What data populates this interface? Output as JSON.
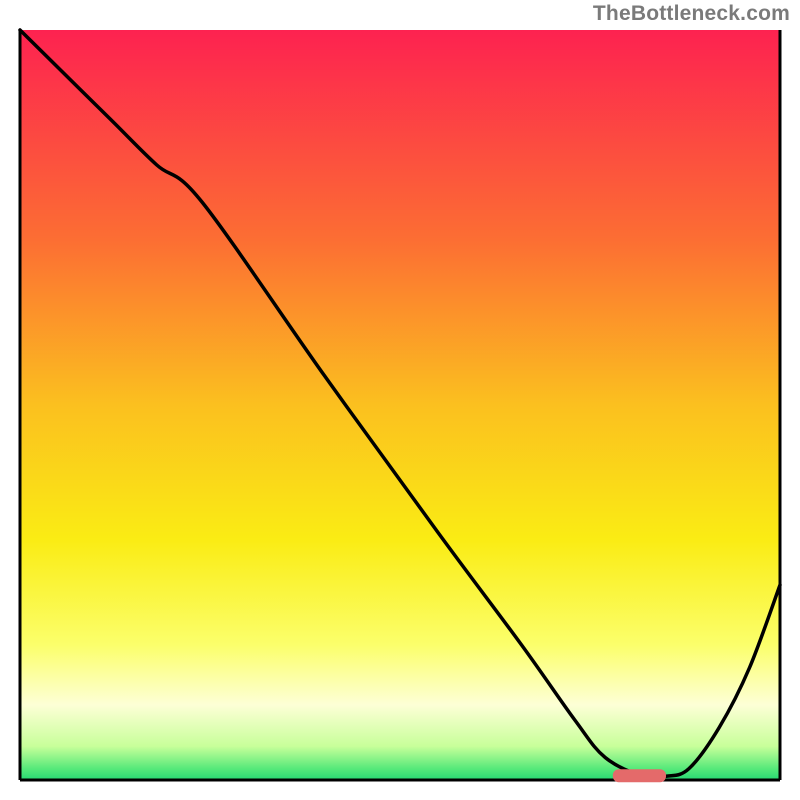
{
  "attribution": "TheBottleneck.com",
  "chart_data": {
    "type": "line",
    "title": "",
    "xlabel": "",
    "ylabel": "",
    "xlim": [
      0,
      100
    ],
    "ylim": [
      0,
      100
    ],
    "gradient_stops": [
      {
        "offset": 0.0,
        "color": "#fd2250"
      },
      {
        "offset": 0.28,
        "color": "#fc6e33"
      },
      {
        "offset": 0.5,
        "color": "#fbc01f"
      },
      {
        "offset": 0.68,
        "color": "#faec14"
      },
      {
        "offset": 0.82,
        "color": "#fbff6b"
      },
      {
        "offset": 0.9,
        "color": "#fdffd6"
      },
      {
        "offset": 0.955,
        "color": "#c8ff9a"
      },
      {
        "offset": 0.985,
        "color": "#56e97a"
      },
      {
        "offset": 1.0,
        "color": "#26d873"
      }
    ],
    "series": [
      {
        "name": "bottleneck-curve",
        "x": [
          0,
          3,
          12,
          18,
          24,
          40,
          55,
          66,
          73,
          77,
          82,
          85,
          88,
          92,
          96,
          100
        ],
        "y": [
          100,
          97,
          88,
          82,
          77,
          54,
          33,
          18,
          8,
          3,
          0.5,
          0.5,
          1.5,
          7,
          15,
          26
        ],
        "note": "y is height above baseline as percent of plot height; curve traces a deep V with minimum plateau near x≈80–85 and rises again toward right edge."
      }
    ],
    "marker": {
      "name": "optimal-range-marker",
      "x_start": 78,
      "x_end": 85,
      "y": 0.5,
      "color": "#e46a6a"
    }
  }
}
